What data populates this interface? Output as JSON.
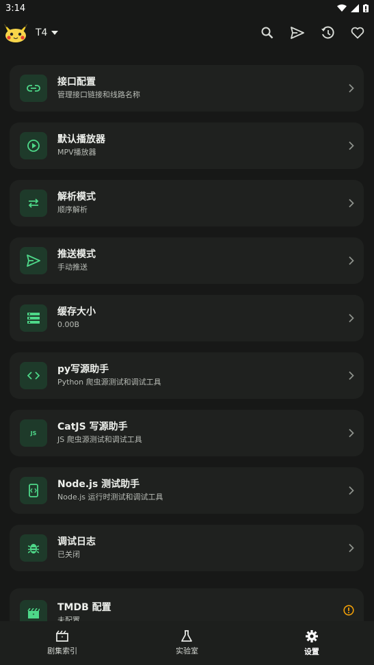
{
  "status_bar": {
    "time": "3:14"
  },
  "app_bar": {
    "title": "T4"
  },
  "settings_items": [
    {
      "title": "接口配置",
      "subtitle": "管理接口链接和线路名称",
      "icon": "link-icon"
    },
    {
      "title": "默认播放器",
      "subtitle": "MPV播放器",
      "icon": "play-circle-icon"
    },
    {
      "title": "解析模式",
      "subtitle": "顺序解析",
      "icon": "swap-arrows-icon"
    },
    {
      "title": "推送模式",
      "subtitle": "手动推送",
      "icon": "send-icon"
    },
    {
      "title": "缓存大小",
      "subtitle": "0.00B",
      "icon": "storage-icon"
    },
    {
      "title": "py写源助手",
      "subtitle": "Python 爬虫源测试和调试工具",
      "icon": "code-icon"
    },
    {
      "title": "CatJS 写源助手",
      "subtitle": "JS 爬虫源测试和调试工具",
      "icon": "js-icon",
      "icon_text": "JS"
    },
    {
      "title": "Node.js 测试助手",
      "subtitle": "Node.js 运行时测试和调试工具",
      "icon": "phone-code-icon"
    },
    {
      "title": "调试日志",
      "subtitle": "已关闭",
      "icon": "bug-icon"
    },
    {
      "title": "TMDB 配置",
      "subtitle": "未配置",
      "icon": "movie-icon",
      "status": "warning"
    }
  ],
  "bottom_nav": [
    {
      "label": "剧集索引",
      "icon": "movie-index-icon",
      "active": false
    },
    {
      "label": "实验室",
      "icon": "flask-icon",
      "active": false
    },
    {
      "label": "设置",
      "icon": "gear-icon",
      "active": true
    }
  ],
  "colors": {
    "background": "#171817",
    "card": "#1f211f",
    "accent": "#4ed889",
    "icon_bg": "#1e3a2a",
    "warning": "#f2a007"
  }
}
